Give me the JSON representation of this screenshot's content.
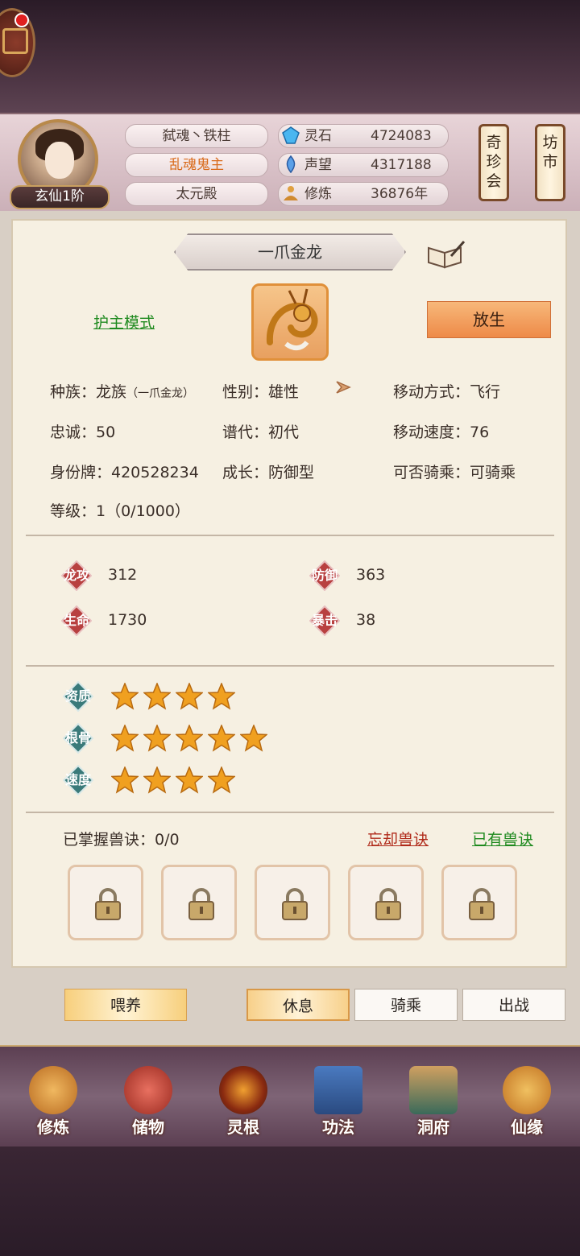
{
  "header": {
    "rank": "玄仙1阶",
    "info_pills": [
      "弑魂丶铁柱",
      "乱魂鬼主",
      "太元殿"
    ],
    "resources": [
      {
        "label": "灵石",
        "value": "4724083",
        "icon": "spirit-stone-icon"
      },
      {
        "label": "声望",
        "value": "4317188",
        "icon": "reputation-icon"
      },
      {
        "label": "修炼",
        "value": "36876年",
        "icon": "meditation-icon"
      }
    ],
    "side_buttons": [
      "奇珍会",
      "坊市"
    ]
  },
  "pet": {
    "name": "一爪金龙",
    "mode": "护主模式",
    "release": "放生",
    "race_label": "种族：",
    "race_value": "龙族",
    "race_detail": "（一爪金龙）",
    "gender": "性别：雄性",
    "move_type": "移动方式：飞行",
    "loyalty": "忠诚：50",
    "generation": "谱代：初代",
    "move_speed": "移动速度：76",
    "id_tag": "身份牌：420528234",
    "growth": "成长：防御型",
    "rideable": "可否骑乘：可骑乘",
    "level": "等级：1（0/1000）"
  },
  "stats": [
    {
      "label": "龙攻",
      "value": "312"
    },
    {
      "label": "防御",
      "value": "363"
    },
    {
      "label": "生命",
      "value": "1730"
    },
    {
      "label": "暴击",
      "value": "38"
    }
  ],
  "ratings": [
    {
      "label": "资质",
      "stars": 4
    },
    {
      "label": "根骨",
      "stars": 5
    },
    {
      "label": "速度",
      "stars": 4
    }
  ],
  "skills": {
    "mastered": "已掌握兽诀：0/0",
    "forget": "忘却兽诀",
    "owned": "已有兽诀",
    "slots": 5
  },
  "actions": {
    "feed": "喂养",
    "tabs": [
      "休息",
      "骑乘",
      "出战"
    ],
    "active_tab": "休息"
  },
  "nav": [
    "修炼",
    "储物",
    "灵根",
    "功法",
    "洞府",
    "仙缘"
  ],
  "colors": {
    "accent_orange": "#ee8a48",
    "link_green": "#1f8a1f",
    "link_red": "#b02a1a",
    "star": "#f0a020"
  }
}
